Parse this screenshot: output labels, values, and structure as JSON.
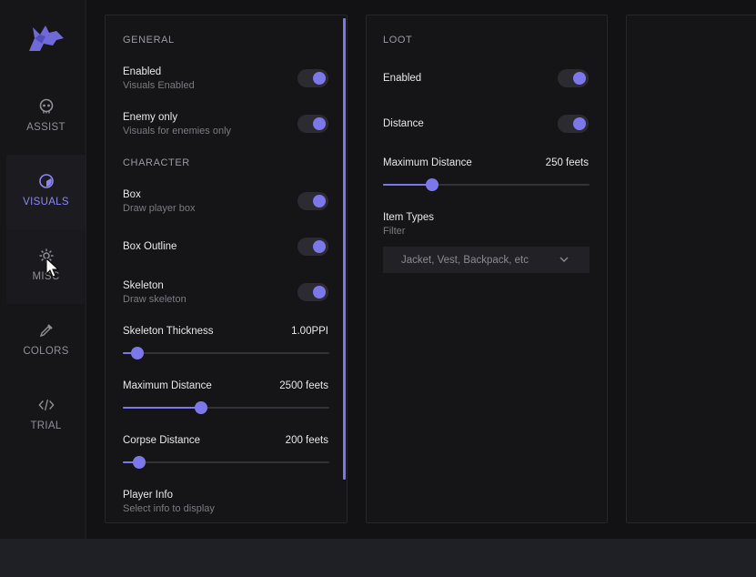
{
  "accent_color": "#7c78ea",
  "sidebar": {
    "logo_icon": "wolf-logo-icon",
    "items": [
      {
        "label": "ASSIST",
        "icon": "skull-icon"
      },
      {
        "label": "VISUALS",
        "icon": "eye-icon",
        "active": true
      },
      {
        "label": "MISC",
        "icon": "gear-icon"
      },
      {
        "label": "COLORS",
        "icon": "eyedropper-icon"
      },
      {
        "label": "TRIAL",
        "icon": "code-icon"
      }
    ]
  },
  "general": {
    "title": "GENERAL",
    "enabled": {
      "label": "Enabled",
      "sub": "Visuals Enabled",
      "on": true
    },
    "enemy_only": {
      "label": "Enemy only",
      "sub": "Visuals for enemies only",
      "on": true
    }
  },
  "character": {
    "title": "CHARACTER",
    "box": {
      "label": "Box",
      "sub": "Draw player box",
      "on": true
    },
    "box_outline": {
      "label": "Box Outline",
      "on": true
    },
    "skeleton": {
      "label": "Skeleton",
      "sub": "Draw skeleton",
      "on": true
    },
    "skeleton_thickness": {
      "label": "Skeleton Thickness",
      "value": "1.00PPI",
      "fraction": 0.07
    },
    "max_distance": {
      "label": "Maximum Distance",
      "value": "2500 feets",
      "fraction": 0.38
    },
    "corpse_distance": {
      "label": "Corpse Distance",
      "value": "200 feets",
      "fraction": 0.08
    },
    "player_info": {
      "label": "Player Info",
      "sub": "Select info to display"
    }
  },
  "loot": {
    "title": "LOOT",
    "enabled": {
      "label": "Enabled",
      "on": true
    },
    "distance": {
      "label": "Distance",
      "on": true
    },
    "max_distance": {
      "label": "Maximum Distance",
      "value": "250 feets",
      "fraction": 0.24
    },
    "item_types": {
      "label": "Item Types",
      "sub": "Filter",
      "selected": "Jacket, Vest, Backpack, etc"
    }
  }
}
